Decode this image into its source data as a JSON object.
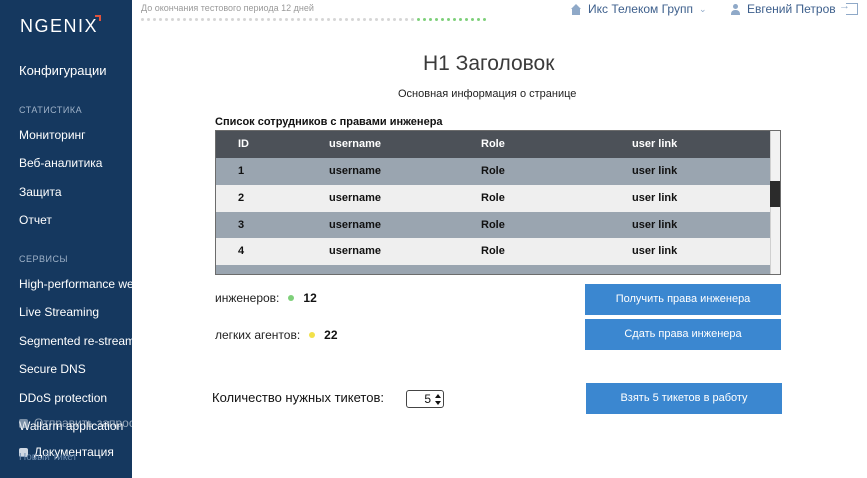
{
  "sidebar": {
    "logo": "NGENIX",
    "configurations": "Конфигурации",
    "stats_title": "СТАТИСТИКА",
    "stats_items": [
      "Мониторинг",
      "Веб-аналитика",
      "Защита",
      "Отчет"
    ],
    "services_title": "СЕРВИСЫ",
    "services_items": [
      "High-performance web",
      "Live Streaming",
      "Segmented re-streaming",
      "Secure DNS",
      "DDoS protection",
      "Wallarm application"
    ],
    "bottom_send": "Отправить запрос",
    "bottom_docs": "Документация",
    "ghost_text": "Новый тикет"
  },
  "topbar": {
    "trial_text": "До окончания тестового периода 12 дней",
    "company": "Икс Телеком Групп",
    "user": "Евгений Петров"
  },
  "main": {
    "h1": "H1 Заголовок",
    "subtitle": "Основная информация о странице",
    "table_title": "Список сотрудников с правами инженера",
    "table": {
      "headers": [
        "ID",
        "username",
        "Role",
        "user link"
      ],
      "rows": [
        [
          "1",
          "username",
          "Role",
          "user link"
        ],
        [
          "2",
          "username",
          "Role",
          "user link"
        ],
        [
          "3",
          "username",
          "Role",
          "user link"
        ],
        [
          "4",
          "username",
          "Role",
          "user link"
        ]
      ]
    },
    "engineers_label": "инженеров:",
    "engineers_count": "12",
    "engineers_dot_color": "#7ed07a",
    "agents_label": "легких агентов:",
    "agents_count": "22",
    "agents_dot_color": "#f2e14a",
    "btn_get_rights": "Получить права инженера",
    "btn_give_rights": "Сдать права инженера",
    "tickets_label": "Количество нужных тикетов:",
    "tickets_value": "5",
    "btn_take_tickets": "Взять 5 тикетов в работу",
    "accent_color": "#3b87d0"
  }
}
